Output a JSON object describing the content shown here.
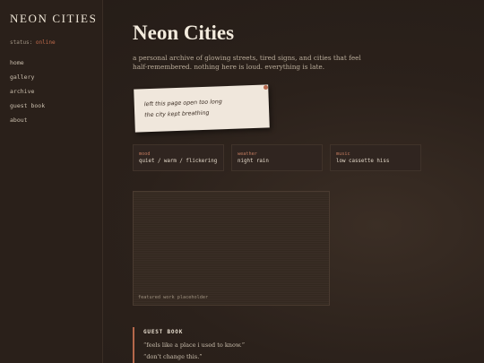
{
  "sidebar": {
    "site_title": "NEON CITIES",
    "status_label": "status:",
    "status_value": "online",
    "nav": [
      "home",
      "gallery",
      "archive",
      "guest book",
      "about"
    ]
  },
  "main": {
    "title": "Neon Cities",
    "subtitle": "a personal archive of glowing streets, tired signs, and cities that feel half-remembered. nothing here is loud. everything is late.",
    "note": {
      "line1": "left this page open too long",
      "line2": "the city kept breathing"
    },
    "info_cards": [
      {
        "key": "mood",
        "value": "quiet / warm / flickering"
      },
      {
        "key": "weather",
        "value": "night rain"
      },
      {
        "key": "music",
        "value": "low cassette hiss"
      }
    ],
    "placeholder_caption": "featured work placeholder",
    "guest_book": {
      "title": "GUEST BOOK",
      "entries": [
        "“feels like a place i used to know.”",
        "“don't change this.”"
      ]
    }
  },
  "colors": {
    "background": "#2b211b",
    "accent": "#c06a4c",
    "note_paper": "#f0e7dc"
  }
}
